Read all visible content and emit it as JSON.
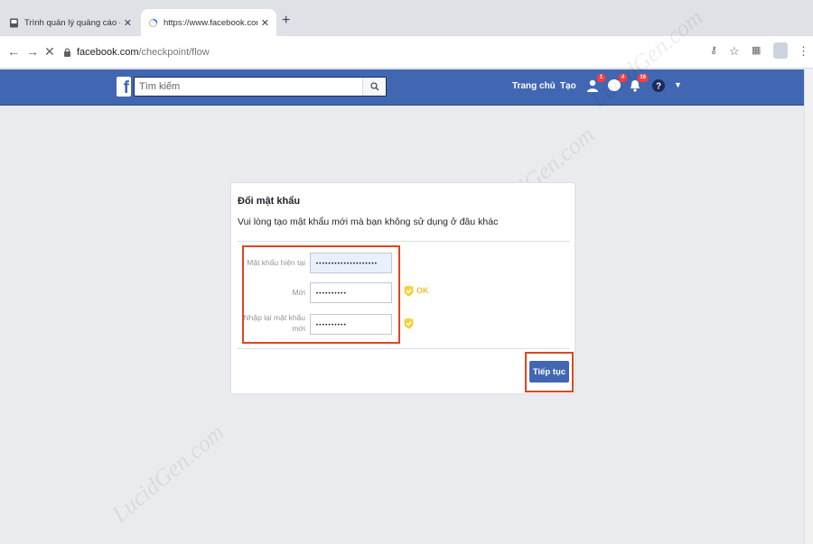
{
  "browser": {
    "tabs": [
      {
        "title": "Trình quản lý quảng cáo - Quản",
        "active": false
      },
      {
        "title": "https://www.facebook.com/che",
        "active": true
      }
    ],
    "url_host": "facebook.com",
    "url_path": "/checkpoint/flow"
  },
  "fb": {
    "search_placeholder": "Tìm kiếm",
    "nav_home": "Trang chủ",
    "nav_create": "Tạo",
    "badges": {
      "friends": "1",
      "messages": "4",
      "notifications": "16"
    },
    "brand_color": "#4267b2"
  },
  "card": {
    "title": "Đổi mật khẩu",
    "subtitle": "Vui lòng tạo mật khẩu mới mà bạn không sử dụng ở đâu khác",
    "fields": [
      {
        "label": "Mật khẩu hiện tại",
        "value": "••••••••••••••••••••"
      },
      {
        "label": "Mới",
        "value": "••••••••••"
      },
      {
        "label": "Nhập lại mật khẩu mới",
        "value": "••••••••••"
      }
    ],
    "ok_text": "OK",
    "continue_label": "Tiếp tục",
    "highlight_color": "#e0451f"
  },
  "watermark": "LucidGen.com"
}
